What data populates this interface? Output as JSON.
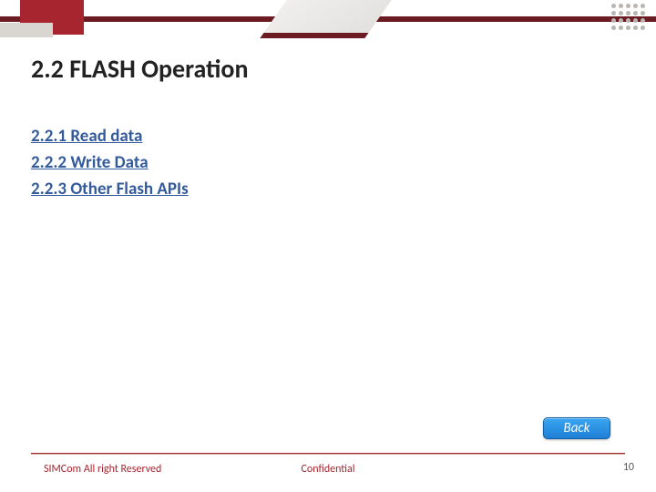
{
  "title": "2.2 FLASH Operation",
  "toc": {
    "items": [
      {
        "label": "2.2.1 Read data"
      },
      {
        "label": "2.2.2 Write Data"
      },
      {
        "label": "2.2.3 Other Flash APIs"
      }
    ]
  },
  "buttons": {
    "back": "Back"
  },
  "footer": {
    "left": "SIMCom All right Reserved",
    "center": "Confidential",
    "page": "10"
  }
}
